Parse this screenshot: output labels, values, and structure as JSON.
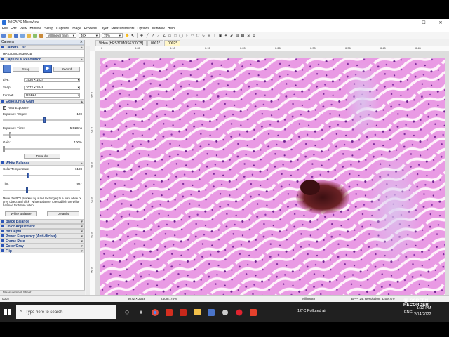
{
  "window": {
    "title": "MICAPS-MicroView",
    "controls": [
      "—",
      "☐",
      "✕"
    ]
  },
  "menu": [
    "File",
    "Edit",
    "View",
    "Browse",
    "Setup",
    "Capture",
    "Image",
    "Process",
    "Layer",
    "Measurements",
    "Options",
    "Window",
    "Help"
  ],
  "toolbar": {
    "unit": "Millimeter (mm)",
    "magnification": "40X",
    "zoom": "75%"
  },
  "panel": {
    "header": "Camera",
    "camera_list_title": "Camera List",
    "camera_name": "HPS3CMOS6300CB",
    "capture_title": "Capture & Resolution",
    "snap_label": "Snap",
    "record_label": "Record",
    "live_label": "Live:",
    "live_value": "1536 × 1024",
    "snap_res_label": "Snap:",
    "snap_res_value": "3072 × 2048",
    "format_label": "Format:",
    "format_value": "RGB24",
    "exposure_title": "Exposure & Gain",
    "auto_exposure_label": "Auto Exposure",
    "exposure_target_label": "Exposure Target:",
    "exposure_target_value": "120",
    "exposure_time_label": "Exposure Time:",
    "exposure_time_value": "5.513ms",
    "gain_label": "Gain:",
    "gain_value": "100%",
    "defaults_label": "Defaults",
    "wb_title": "White Balance",
    "color_temp_label": "Color Temperature:",
    "color_temp_value": "6198",
    "tint_label": "Tint:",
    "tint_value": "927",
    "wb_note": "Move the ROI (Marked by a red rectangle) to a pure white or grey object and click \"White Balance\" to establish the white balance for future video.",
    "wb_button": "White Balance",
    "wb_defaults": "Defaults",
    "collapsed_sections": [
      "Black Balance",
      "Color Adjustment",
      "Bit Depth",
      "Power Frequency (Anti-flicker)",
      "Frame Rate",
      "Color/Gray",
      "Flip"
    ]
  },
  "tabs": [
    {
      "label": "Video [HPS3CMOS6300CB]",
      "active": false
    },
    {
      "label": "0001*",
      "active": false
    },
    {
      "label": "0002*",
      "active": true
    }
  ],
  "ruler": {
    "top_labels": [
      "0",
      "0.05",
      "0.10",
      "0.15",
      "0.20",
      "0.25",
      "0.30",
      "0.35",
      "0.40",
      "0.45"
    ],
    "left_labels": [
      "0.05",
      "0.10",
      "0.15",
      "0.20",
      "0.25",
      "0.30"
    ]
  },
  "status": {
    "file": "0002",
    "size": "3072 × 2048",
    "zoom": "Zoom: 75%",
    "unit": "Millimeter",
    "info": "BPP: 24, Resolution: 6209.779",
    "measurement_sheet": "Measurement Sheet"
  },
  "taskbar": {
    "search_placeholder": "Type here to search",
    "weather": "12°C  Polluted air",
    "lang": "ENG",
    "time": "1:12 PM",
    "date": "2/14/2022",
    "watermark": "SCREEN RECORDER"
  },
  "colors": {
    "tissue_base": "#f4c9ef",
    "stain_dark": "#7c2a9a",
    "deposit": "#5a1a1e",
    "accent": "#2c56b8"
  }
}
